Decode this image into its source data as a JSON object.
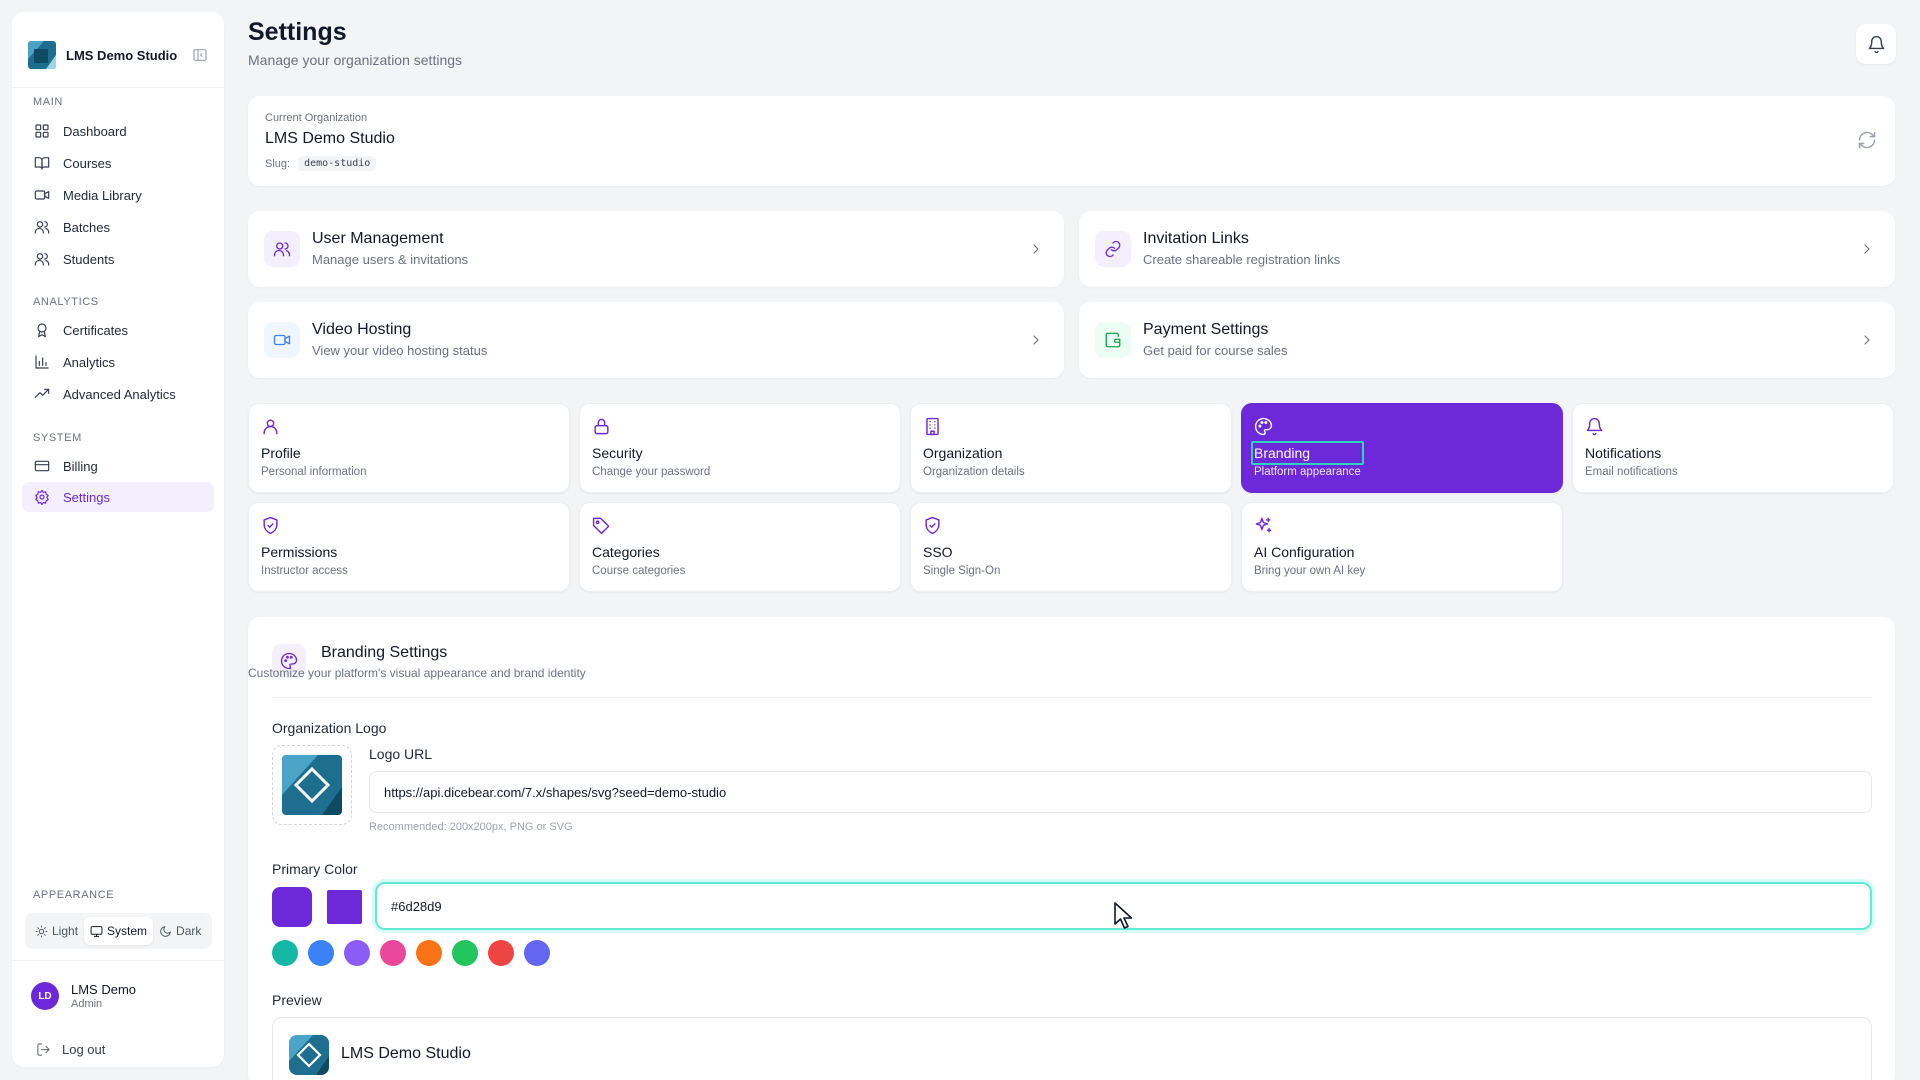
{
  "sidebar": {
    "brand": "LMS Demo Studio",
    "sections": {
      "main": "MAIN",
      "analytics": "ANALYTICS",
      "system": "SYSTEM",
      "appearance": "APPEARANCE"
    },
    "items": [
      {
        "label": "Dashboard",
        "icon": "dashboard-icon"
      },
      {
        "label": "Courses",
        "icon": "book-open-icon"
      },
      {
        "label": "Media Library",
        "icon": "video-icon"
      },
      {
        "label": "Batches",
        "icon": "users-icon"
      },
      {
        "label": "Students",
        "icon": "users-icon"
      },
      {
        "label": "Certificates",
        "icon": "award-icon"
      },
      {
        "label": "Analytics",
        "icon": "bar-chart-icon"
      },
      {
        "label": "Advanced Analytics",
        "icon": "trending-up-icon"
      },
      {
        "label": "Billing",
        "icon": "credit-card-icon"
      },
      {
        "label": "Settings",
        "icon": "gear-icon",
        "active": true
      }
    ],
    "theme": {
      "light": "Light",
      "system": "System",
      "dark": "Dark",
      "selected": "System"
    },
    "user": {
      "initials": "LD",
      "name": "LMS Demo",
      "role": "Admin"
    },
    "logout": "Log out"
  },
  "header": {
    "title": "Settings",
    "subtitle": "Manage your organization settings"
  },
  "org": {
    "label": "Current Organization",
    "name": "LMS Demo Studio",
    "slug_label": "Slug:",
    "slug": "demo-studio"
  },
  "quick_links": [
    {
      "title": "User Management",
      "subtitle": "Manage users & invitations",
      "icon": "users-icon"
    },
    {
      "title": "Invitation Links",
      "subtitle": "Create shareable registration links",
      "icon": "link-icon"
    },
    {
      "title": "Video Hosting",
      "subtitle": "View your video hosting status",
      "icon": "video-icon"
    },
    {
      "title": "Payment Settings",
      "subtitle": "Get paid for course sales",
      "icon": "wallet-icon"
    }
  ],
  "tiles": [
    {
      "title": "Profile",
      "subtitle": "Personal information",
      "icon": "user-icon"
    },
    {
      "title": "Security",
      "subtitle": "Change your password",
      "icon": "lock-icon"
    },
    {
      "title": "Organization",
      "subtitle": "Organization details",
      "icon": "building-icon"
    },
    {
      "title": "Branding",
      "subtitle": "Platform appearance",
      "icon": "palette-icon",
      "active": true
    },
    {
      "title": "Notifications",
      "subtitle": "Email notifications",
      "icon": "bell-icon"
    },
    {
      "title": "Permissions",
      "subtitle": "Instructor access",
      "icon": "shield-check-icon"
    },
    {
      "title": "Categories",
      "subtitle": "Course categories",
      "icon": "tag-icon"
    },
    {
      "title": "SSO",
      "subtitle": "Single Sign-On",
      "icon": "shield-check-icon"
    },
    {
      "title": "AI Configuration",
      "subtitle": "Bring your own AI key",
      "icon": "sparkles-icon"
    }
  ],
  "branding": {
    "title": "Branding Settings",
    "subtitle": "Customize your platform's visual appearance and brand identity",
    "logo_label": "Organization Logo",
    "logo_url_label": "Logo URL",
    "logo_url": "https://api.dicebear.com/7.x/shapes/svg?seed=demo-studio",
    "logo_hint": "Recommended: 200x200px, PNG or SVG",
    "primary_color_label": "Primary Color",
    "primary_color": "#6d28d9",
    "presets": [
      "#14b8a6",
      "#3b82f6",
      "#8b5cf6",
      "#ec4899",
      "#f97316",
      "#22c55e",
      "#ef4444",
      "#6366f1"
    ],
    "preview_label": "Preview",
    "preview_name": "LMS Demo Studio"
  },
  "colors": {
    "accent": "#6d28d9",
    "accent_light": "#f3effd",
    "focus_ring": "#5eead4"
  }
}
